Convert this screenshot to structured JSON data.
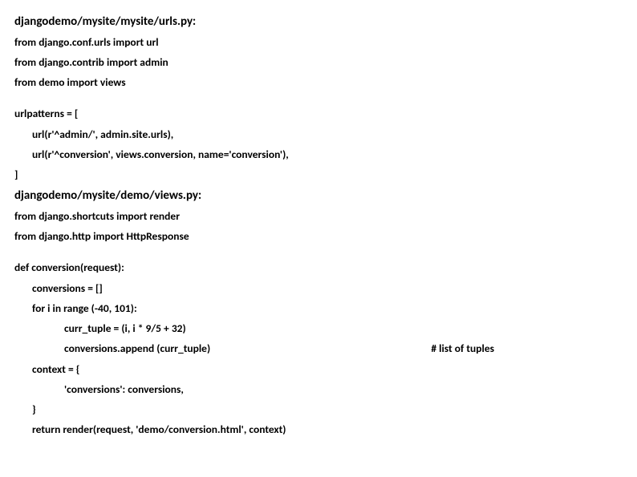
{
  "urls": {
    "heading": "djangodemo/mysite/mysite/urls.py:",
    "l1": "from django.conf.urls import url",
    "l2": "from django.contrib import admin",
    "l3": "from demo import views",
    "l4": "urlpatterns = [",
    "l5": "url(r'^admin/', admin.site.urls),",
    "l6": "url(r'^conversion', views.conversion, name='conversion'),",
    "l7": "]"
  },
  "views": {
    "heading": "djangodemo/mysite/demo/views.py:",
    "l1": "from django.shortcuts import render",
    "l2": "from django.http import HttpResponse",
    "l3": "def conversion(request):",
    "l4": "conversions = []",
    "l5": "for i in range (-40, 101):",
    "l6": "curr_tuple = (i, i * 9/5 + 32)",
    "l7": "conversions.append (curr_tuple)",
    "l7_comment": "# list of tuples",
    "l8": "context = {",
    "l9": "'conversions': conversions,",
    "l10": "}",
    "l11": "return render(request, 'demo/conversion.html', context)"
  }
}
